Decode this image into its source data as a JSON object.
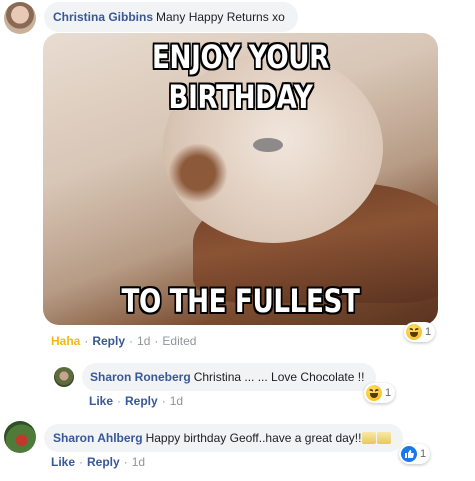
{
  "comments": [
    {
      "author": "Christina Gibbins",
      "text": "Many Happy Returns xo",
      "meme": {
        "top_text": "ENJOY YOUR BIRTHDAY",
        "bottom_text": "TO THE FULLEST"
      },
      "reaction_count": "1",
      "actions": {
        "reaction_label": "Haha",
        "reply": "Reply",
        "time": "1d",
        "edited": "Edited"
      }
    },
    {
      "author": "Sharon Roneberg",
      "text": "Christina ... ... Love Chocolate !!",
      "reaction_count": "1",
      "actions": {
        "like": "Like",
        "reply": "Reply",
        "time": "1d"
      }
    },
    {
      "author": "Sharon Ahlberg",
      "text": "Happy birthday Geoff..have a great day!!",
      "reaction_count": "1",
      "actions": {
        "like": "Like",
        "reply": "Reply",
        "time": "1d"
      }
    }
  ],
  "colors": {
    "author": "#385898",
    "haha": "#f0ba15",
    "bubble": "#f2f3f5",
    "like": "#1877f2"
  }
}
